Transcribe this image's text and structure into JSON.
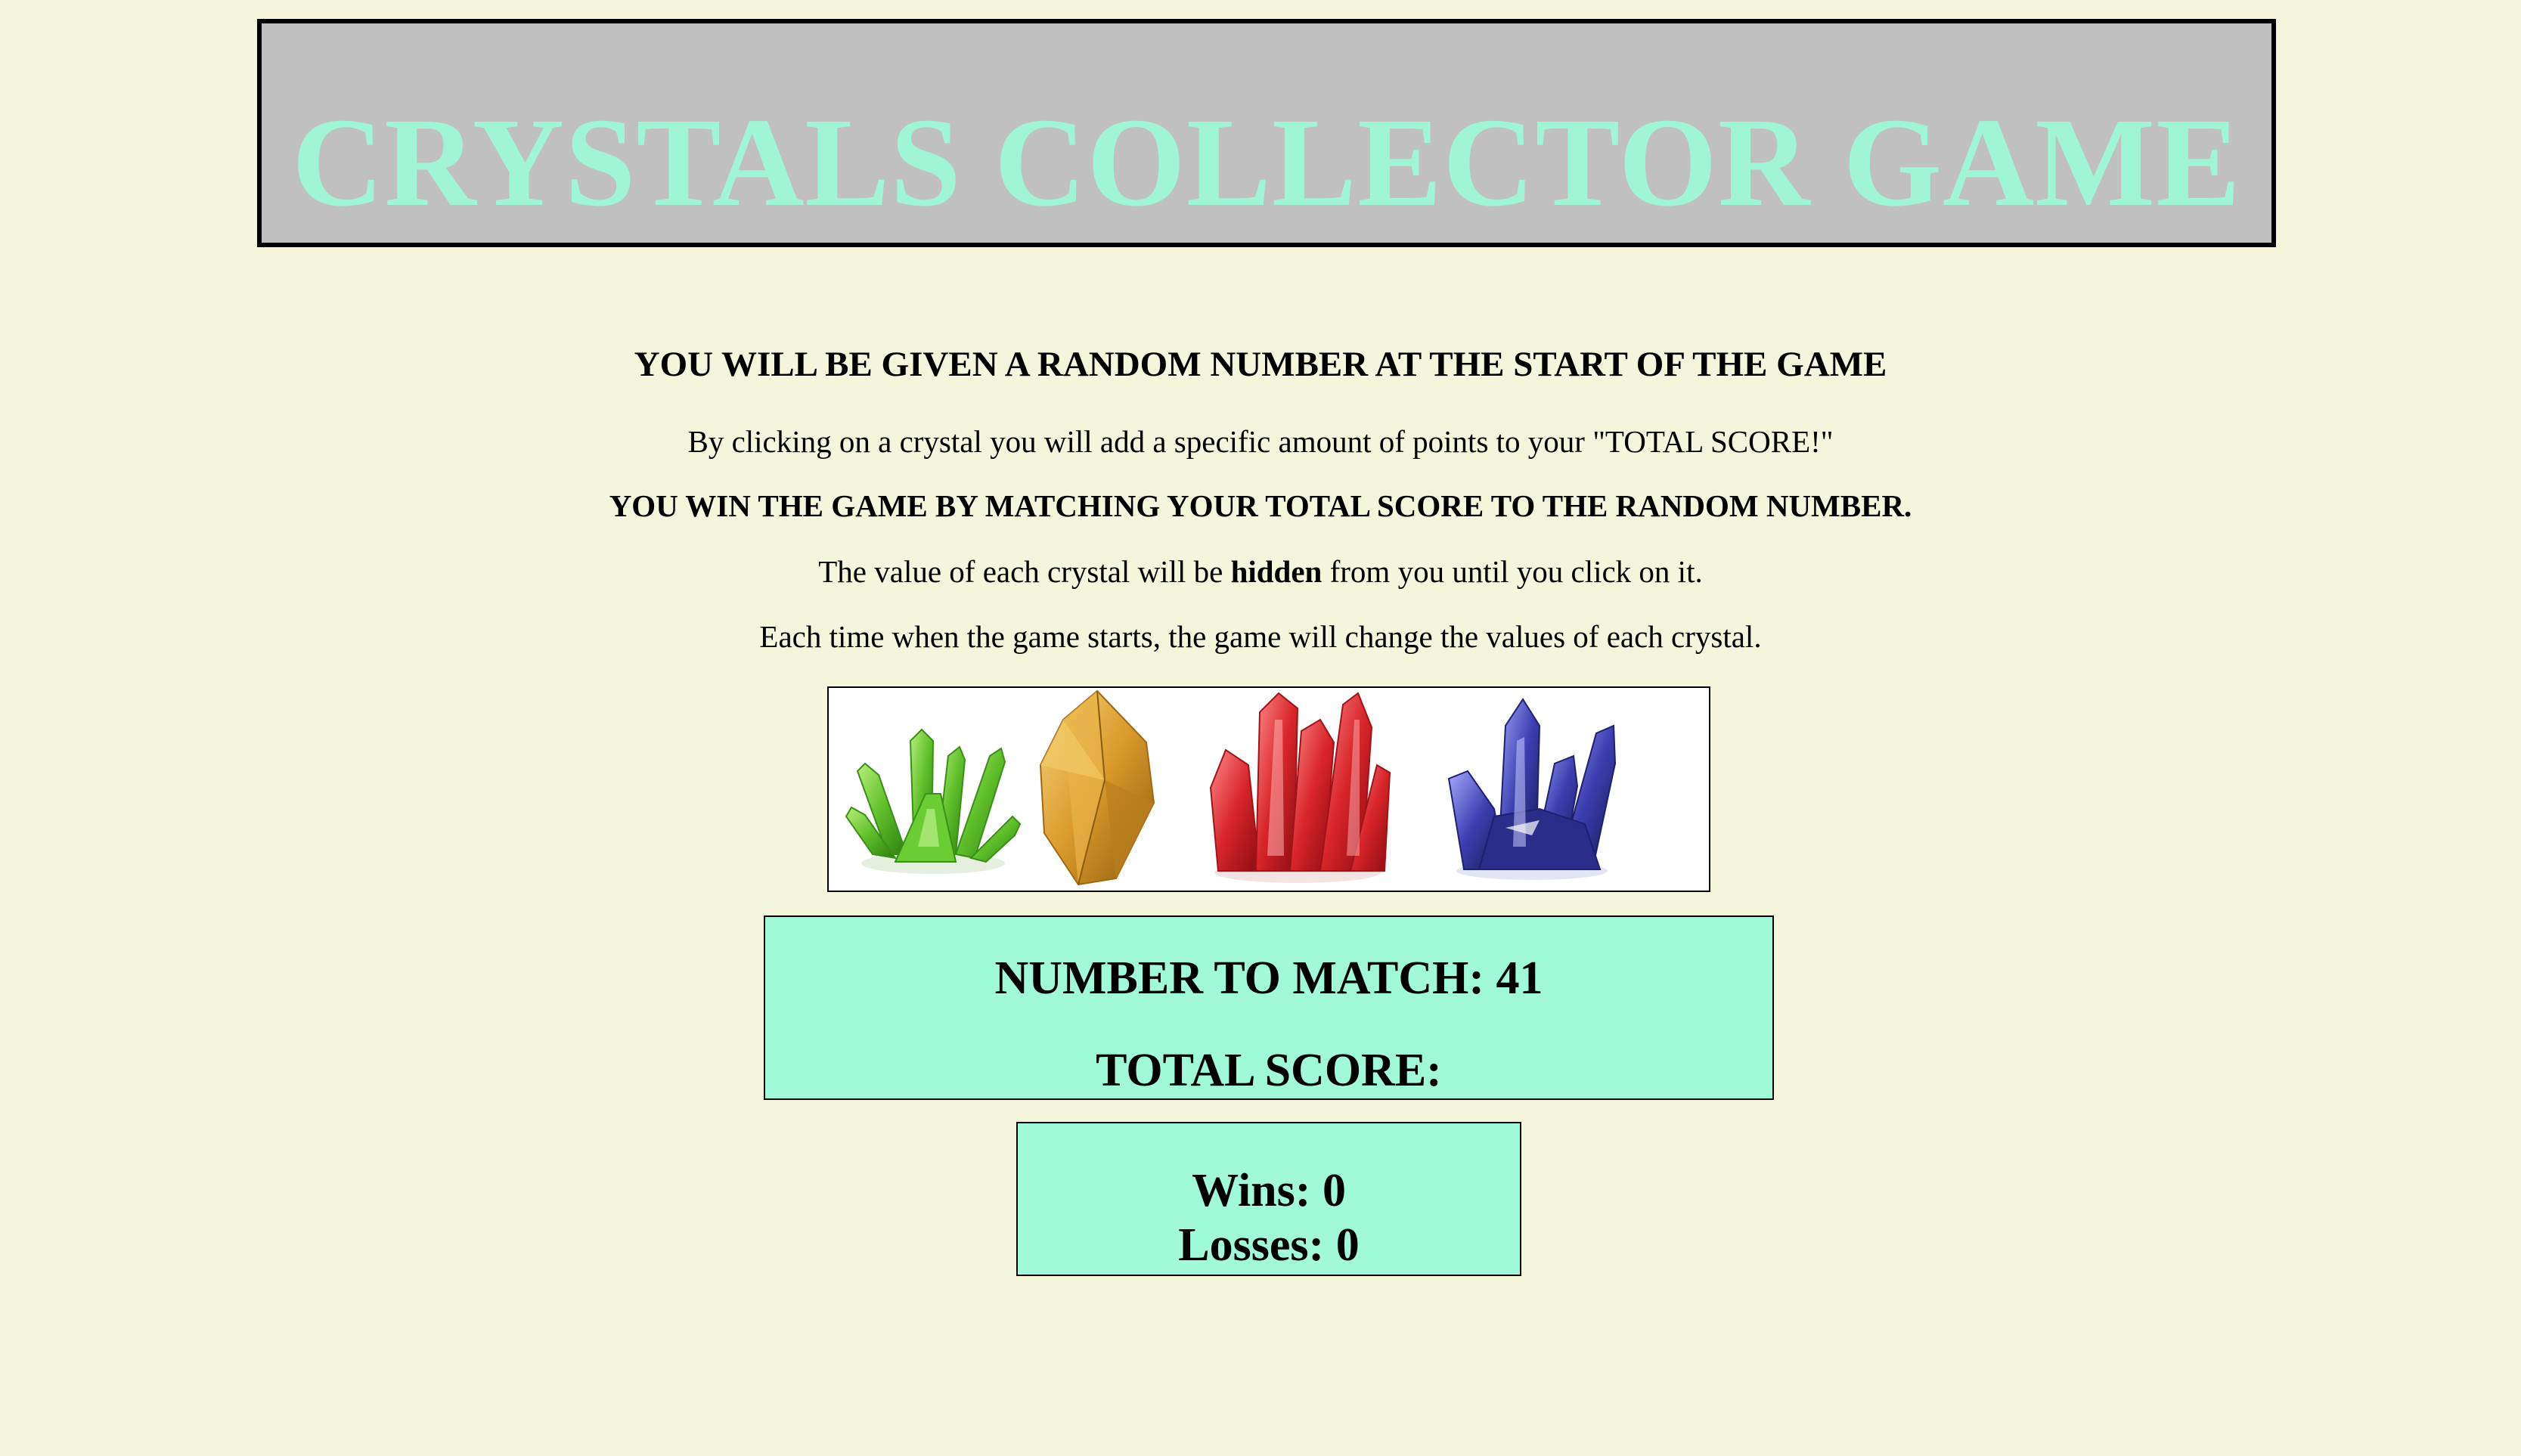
{
  "header": {
    "title": "CRYSTALS COLLECTOR GAME"
  },
  "instructions": {
    "line1": "YOU WILL BE GIVEN A RANDOM NUMBER AT THE START OF THE GAME",
    "line2": "By clicking on a crystal you will add a specific amount of points to your \"TOTAL SCORE!\"",
    "line3": "YOU WIN THE GAME BY MATCHING YOUR TOTAL SCORE TO THE RANDOM NUMBER.",
    "line4_before": "The value of each crystal will be ",
    "line4_bold": "hidden",
    "line4_after": " from you until you click on it.",
    "line5": "Each time when the game starts, the game will change the values of each crystal."
  },
  "crystals": [
    {
      "name": "green-crystal-icon",
      "color": "#5fbf2a"
    },
    {
      "name": "yellow-crystal-icon",
      "color": "#d99a2b"
    },
    {
      "name": "red-crystal-icon",
      "color": "#d8252a"
    },
    {
      "name": "blue-crystal-icon",
      "color": "#3b3fb0"
    }
  ],
  "score": {
    "number_label": "NUMBER TO MATCH: ",
    "number_value": "41",
    "total_label": "TOTAL SCORE:",
    "total_value": ""
  },
  "record": {
    "wins_label": "Wins: ",
    "wins_value": "0",
    "losses_label": "Losses: ",
    "losses_value": "0"
  },
  "colors": {
    "background": "#f5f5dc",
    "header_bg": "#c0c0c0",
    "title_color": "#a0f5d7",
    "box_bg": "#a0f9d8"
  }
}
